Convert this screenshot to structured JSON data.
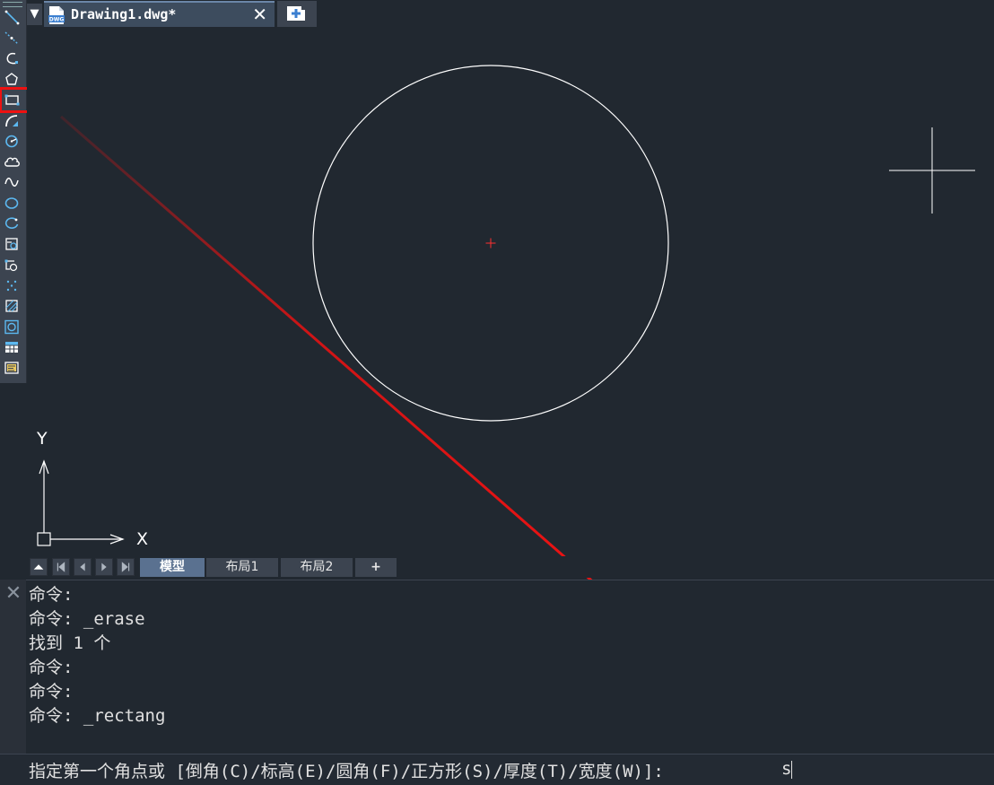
{
  "document_tab": {
    "title": "Drawing1.dwg*",
    "close_glyph": "✕"
  },
  "tab_menu_glyph": "▼",
  "toolbar": {
    "tools": [
      "line-icon",
      "construction-line-icon",
      "polyline-icon",
      "polygon-icon",
      "rectangle-icon",
      "arc-icon",
      "circle-icon",
      "revcloud-icon",
      "spline-icon",
      "ellipse-icon",
      "ellipse-arc-icon",
      "insert-block-icon",
      "create-block-icon",
      "point-icon",
      "hatch-icon",
      "region-icon",
      "table-icon",
      "multiline-text-icon"
    ],
    "highlighted_tool": "rectangle-icon"
  },
  "ucs": {
    "x_label": "X",
    "y_label": "Y"
  },
  "layout_tabs": [
    {
      "label": "模型",
      "active": true
    },
    {
      "label": "布局1",
      "active": false
    },
    {
      "label": "布局2",
      "active": false
    },
    {
      "label": "+",
      "active": false
    }
  ],
  "command": {
    "close_glyph": "✕",
    "history": [
      "命令:",
      "命令: _erase",
      "找到 1 个",
      "命令:",
      "命令:",
      "命令: _rectang"
    ],
    "prompt": "指定第一个角点或 [倒角(C)/标高(E)/圆角(F)/正方形(S)/厚度(T)/宽度(W)]:",
    "input_value": "s"
  },
  "colors": {
    "canvas": "#212830",
    "accent_red": "#ee1111",
    "ui_panel": "#3c4450",
    "active_tab": "#5a7190"
  }
}
